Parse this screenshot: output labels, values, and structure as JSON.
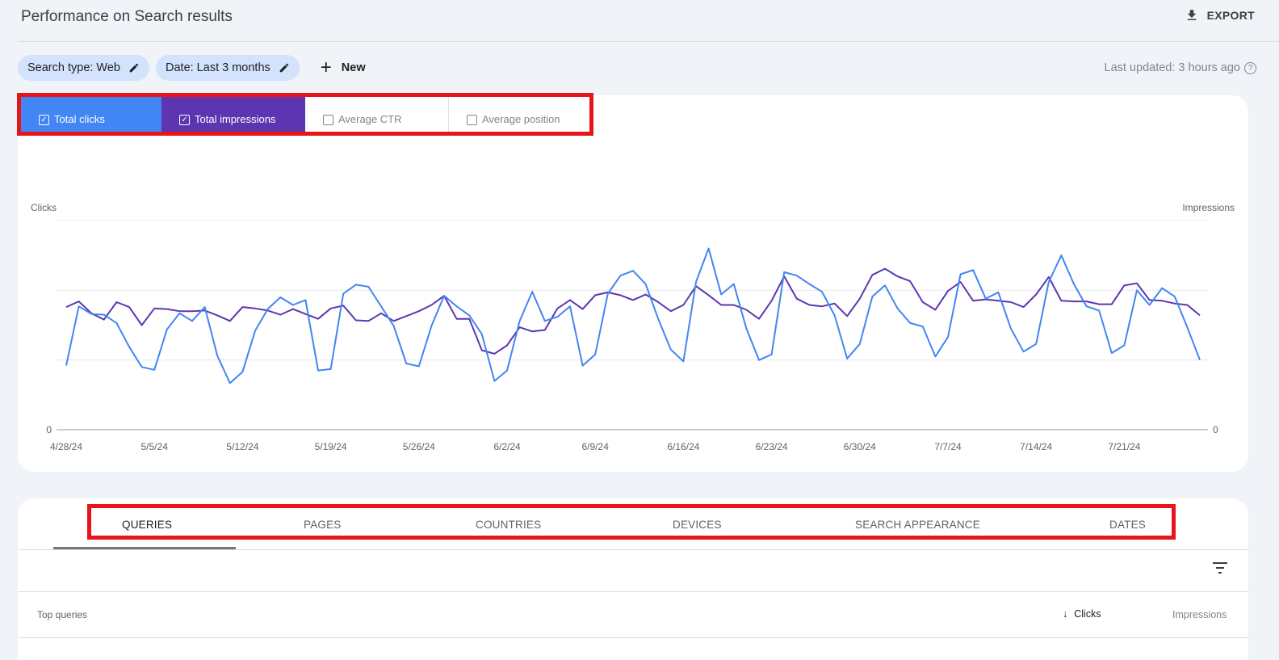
{
  "header": {
    "title": "Performance on Search results",
    "export_label": "EXPORT"
  },
  "filters": {
    "chips": [
      {
        "label": "Search type: Web"
      },
      {
        "label": "Date: Last 3 months"
      }
    ],
    "new_label": "New",
    "last_updated": "Last updated: 3 hours ago",
    "help_glyph": "?"
  },
  "metrics": [
    {
      "label": "Total clicks",
      "checked": true,
      "color": "#4285f4"
    },
    {
      "label": "Total impressions",
      "checked": true,
      "color": "#5e35b1"
    },
    {
      "label": "Average CTR",
      "checked": false
    },
    {
      "label": "Average position",
      "checked": false
    }
  ],
  "chart_data": {
    "type": "line",
    "title": "",
    "ylabel_left": "Clicks",
    "ylabel_right": "Impressions",
    "y_left_ticks": [
      "0"
    ],
    "y_right_ticks": [
      "0"
    ],
    "ylim": [
      0,
      3
    ],
    "grid": true,
    "gridlines": [
      1,
      2,
      3
    ],
    "x_start": "4/28/24",
    "x_tick_labels": [
      "4/28/24",
      "5/5/24",
      "5/12/24",
      "5/19/24",
      "5/26/24",
      "6/2/24",
      "6/9/24",
      "6/16/24",
      "6/23/24",
      "6/30/24",
      "7/7/24",
      "7/14/24",
      "7/21/24"
    ],
    "x_tick_every_days": 7,
    "note": "Values are relative (axis shows only 0); each point = 1 day starting 4/28/24",
    "series": [
      {
        "name": "Clicks",
        "axis": "left",
        "color": "#4285f4",
        "values": [
          0.92,
          1.77,
          1.66,
          1.65,
          1.53,
          1.19,
          0.9,
          0.86,
          1.44,
          1.67,
          1.56,
          1.76,
          1.06,
          0.67,
          0.83,
          1.42,
          1.73,
          1.9,
          1.79,
          1.86,
          0.85,
          0.87,
          1.95,
          2.08,
          2.05,
          1.77,
          1.49,
          0.95,
          0.91,
          1.49,
          1.92,
          1.77,
          1.64,
          1.37,
          0.7,
          0.85,
          1.56,
          1.98,
          1.56,
          1.62,
          1.77,
          0.92,
          1.08,
          1.95,
          2.21,
          2.28,
          2.09,
          1.59,
          1.15,
          0.98,
          2.12,
          2.6,
          1.94,
          2.09,
          1.45,
          1.0,
          1.08,
          2.26,
          2.21,
          2.09,
          1.98,
          1.64,
          1.02,
          1.23,
          1.91,
          2.07,
          1.74,
          1.53,
          1.48,
          1.05,
          1.33,
          2.23,
          2.29,
          1.88,
          1.97,
          1.45,
          1.12,
          1.23,
          2.12,
          2.5,
          2.09,
          1.77,
          1.71,
          1.1,
          1.21,
          2.0,
          1.79,
          2.03,
          1.91,
          1.47,
          1.0
        ]
      },
      {
        "name": "Impressions",
        "axis": "right",
        "color": "#5e35b1",
        "values": [
          1.76,
          1.84,
          1.67,
          1.58,
          1.83,
          1.76,
          1.5,
          1.74,
          1.73,
          1.7,
          1.7,
          1.71,
          1.64,
          1.56,
          1.76,
          1.74,
          1.71,
          1.65,
          1.73,
          1.66,
          1.59,
          1.74,
          1.78,
          1.57,
          1.56,
          1.67,
          1.56,
          1.63,
          1.7,
          1.79,
          1.92,
          1.59,
          1.59,
          1.14,
          1.09,
          1.21,
          1.47,
          1.41,
          1.43,
          1.74,
          1.86,
          1.73,
          1.93,
          1.97,
          1.93,
          1.86,
          1.94,
          1.83,
          1.7,
          1.79,
          2.06,
          1.93,
          1.79,
          1.79,
          1.72,
          1.59,
          1.85,
          2.2,
          1.88,
          1.79,
          1.77,
          1.81,
          1.63,
          1.88,
          2.22,
          2.31,
          2.2,
          2.13,
          1.83,
          1.72,
          1.99,
          2.12,
          1.85,
          1.87,
          1.85,
          1.83,
          1.76,
          1.94,
          2.19,
          1.85,
          1.84,
          1.84,
          1.8,
          1.8,
          2.07,
          2.1,
          1.86,
          1.85,
          1.81,
          1.79,
          1.64
        ]
      }
    ]
  },
  "tabs": [
    {
      "label": "QUERIES",
      "active": true
    },
    {
      "label": "PAGES"
    },
    {
      "label": "COUNTRIES"
    },
    {
      "label": "DEVICES"
    },
    {
      "label": "SEARCH APPEARANCE"
    },
    {
      "label": "DATES"
    }
  ],
  "table": {
    "first_col": "Top queries",
    "sort_col": "Clicks",
    "sort_direction": "descending",
    "other_col": "Impressions"
  },
  "colors": {
    "clicks": "#4285f4",
    "impressions": "#5e35b1",
    "highlight_box": "#e8141c"
  }
}
